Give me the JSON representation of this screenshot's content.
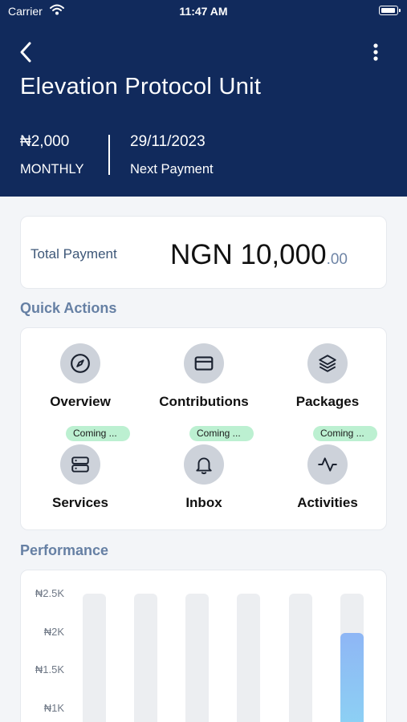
{
  "status_bar": {
    "carrier": "Carrier",
    "time": "11:47 AM"
  },
  "header": {
    "title": "Elevation Protocol Unit",
    "amount": "₦2,000",
    "frequency": "MONTHLY",
    "next_date": "29/11/2023",
    "next_label": "Next Payment",
    "background_color": "#112a5c"
  },
  "total": {
    "label": "Total Payment",
    "amount": "NGN 10,000",
    "cents": ".00"
  },
  "quick_actions": {
    "title": "Quick Actions",
    "items": [
      {
        "label": "Overview",
        "icon": "compass-icon",
        "badge": ""
      },
      {
        "label": "Contributions",
        "icon": "card-icon",
        "badge": ""
      },
      {
        "label": "Packages",
        "icon": "layers-icon",
        "badge": ""
      },
      {
        "label": "Services",
        "icon": "server-icon",
        "badge": "Coming ..."
      },
      {
        "label": "Inbox",
        "icon": "bell-icon",
        "badge": "Coming ..."
      },
      {
        "label": "Activities",
        "icon": "activity-icon",
        "badge": "Coming ..."
      }
    ]
  },
  "performance": {
    "title": "Performance"
  },
  "chart_data": {
    "type": "bar",
    "y_tick_labels": [
      "₦2.5K",
      "₦2K",
      "₦1.5K",
      "₦1K"
    ],
    "ylim": [
      0,
      2500
    ],
    "bar_count": 6,
    "values": [
      0,
      0,
      0,
      0,
      0,
      2000
    ],
    "bar_color": "#8eb6f5",
    "track_color": "#eceef1"
  }
}
